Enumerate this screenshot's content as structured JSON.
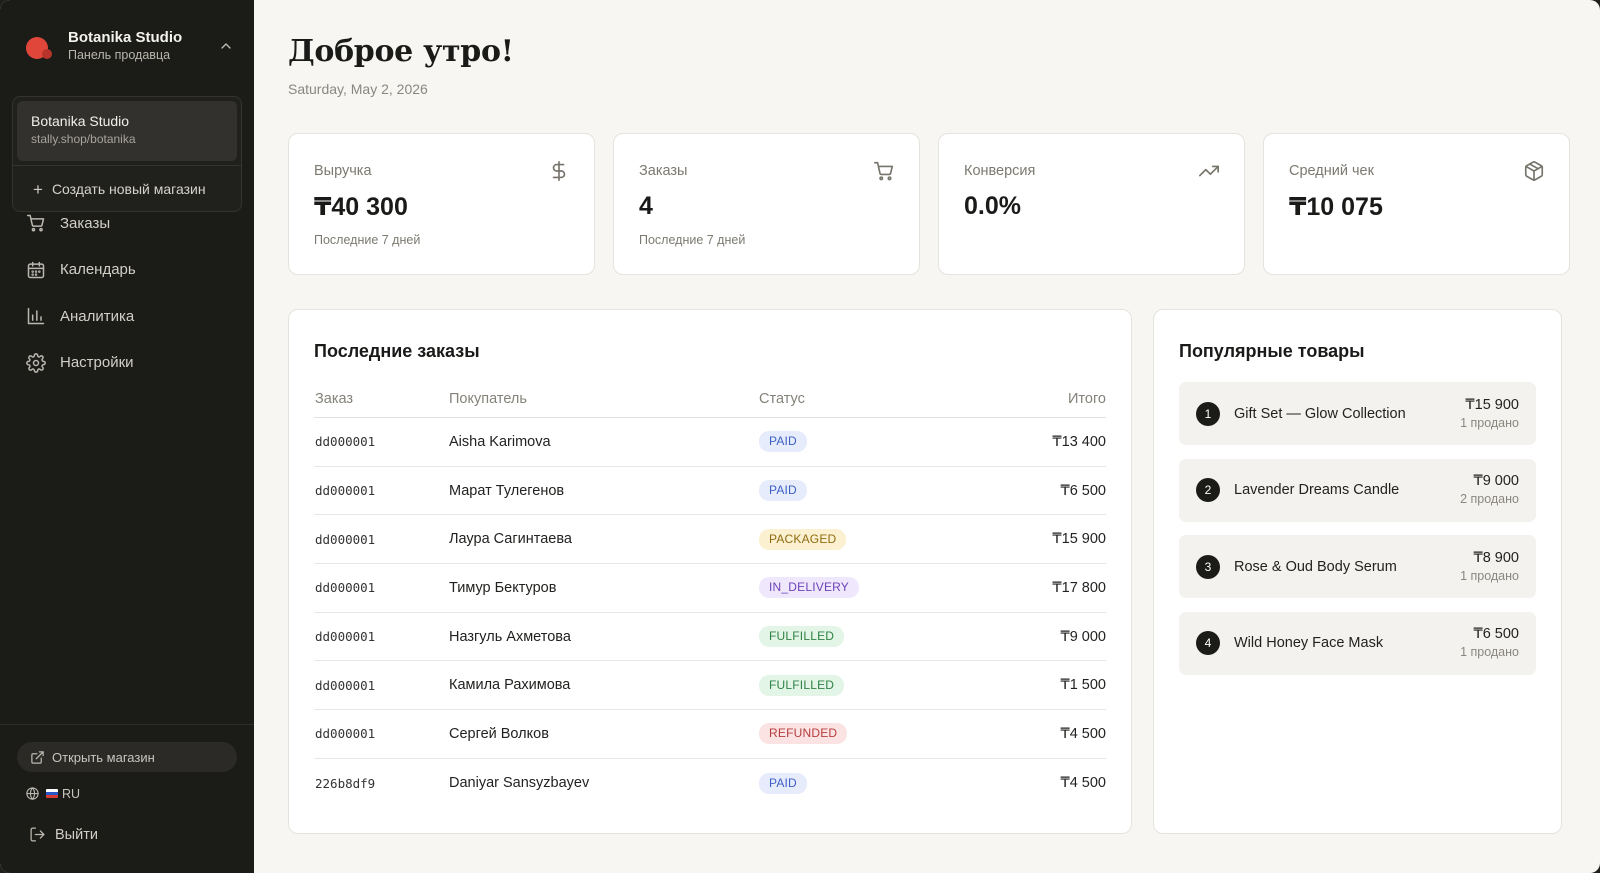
{
  "store": {
    "name": "Botanika Studio",
    "subtitle": "Панель продавца",
    "dropdown": {
      "current_name": "Botanika Studio",
      "current_url": "stally.shop/botanika",
      "create_label": "Создать новый магазин"
    }
  },
  "nav": {
    "items": [
      {
        "label": "Заказы",
        "icon": "cart-icon"
      },
      {
        "label": "Календарь",
        "icon": "calendar-icon"
      },
      {
        "label": "Аналитика",
        "icon": "bar-chart-icon"
      },
      {
        "label": "Настройки",
        "icon": "gear-icon"
      }
    ]
  },
  "sidebar_bottom": {
    "open_shop": "Открыть магазин",
    "language": "RU",
    "logout": "Выйти"
  },
  "header": {
    "greeting": "Доброе утро!",
    "date": "Saturday, May 2, 2026"
  },
  "stats": [
    {
      "label": "Выручка",
      "value": "₸40 300",
      "sub": "Последние 7 дней",
      "icon": "dollar-icon"
    },
    {
      "label": "Заказы",
      "value": "4",
      "sub": "Последние 7 дней",
      "icon": "cart-icon"
    },
    {
      "label": "Конверсия",
      "value": "0.0%",
      "sub": "",
      "icon": "trending-up-icon"
    },
    {
      "label": "Средний чек",
      "value": "₸10 075",
      "sub": "",
      "icon": "box-icon"
    }
  ],
  "orders": {
    "title": "Последние заказы",
    "columns": [
      "Заказ",
      "Покупатель",
      "Статус",
      "Итого"
    ],
    "rows": [
      {
        "id": "dd000001",
        "customer": "Aisha Karimova",
        "status": "PAID",
        "total": "₸13 400"
      },
      {
        "id": "dd000001",
        "customer": "Марат Тулегенов",
        "status": "PAID",
        "total": "₸6 500"
      },
      {
        "id": "dd000001",
        "customer": "Лаура Сагинтаева",
        "status": "PACKAGED",
        "total": "₸15 900"
      },
      {
        "id": "dd000001",
        "customer": "Тимур Бектуров",
        "status": "IN_DELIVERY",
        "total": "₸17 800"
      },
      {
        "id": "dd000001",
        "customer": "Назгуль Ахметова",
        "status": "FULFILLED",
        "total": "₸9 000"
      },
      {
        "id": "dd000001",
        "customer": "Камила Рахимова",
        "status": "FULFILLED",
        "total": "₸1 500"
      },
      {
        "id": "dd000001",
        "customer": "Сергей Волков",
        "status": "REFUNDED",
        "total": "₸4 500"
      },
      {
        "id": "226b8df9",
        "customer": "Daniyar Sansyzbayev",
        "status": "PAID",
        "total": "₸4 500"
      }
    ]
  },
  "popular": {
    "title": "Популярные товары",
    "items": [
      {
        "rank": "1",
        "name": "Gift Set — Glow Collection",
        "price": "₸15 900",
        "sold": "1 продано"
      },
      {
        "rank": "2",
        "name": "Lavender Dreams Candle",
        "price": "₸9 000",
        "sold": "2 продано"
      },
      {
        "rank": "3",
        "name": "Rose & Oud Body Serum",
        "price": "₸8 900",
        "sold": "1 продано"
      },
      {
        "rank": "4",
        "name": "Wild Honey Face Mask",
        "price": "₸6 500",
        "sold": "1 продано"
      }
    ]
  },
  "colors": {
    "sidebar_bg": "#1b1b18",
    "page_bg": "#f7f6f3",
    "brand_red": "#e0463a"
  }
}
